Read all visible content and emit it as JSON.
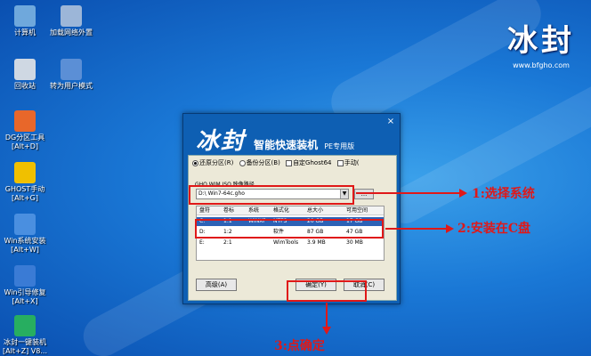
{
  "desktop": {
    "icons": [
      {
        "label": "计算机",
        "color": "#6fa8dc"
      },
      {
        "label": "加载网络外置",
        "color": "#9cb6d8"
      },
      {
        "label": "回收站",
        "color": "#cfd8e3"
      },
      {
        "label": "转为用户模式",
        "color": "#5b8fd6"
      },
      {
        "label": "DG分区工具",
        "label2": "[Alt+D]",
        "color": "#e8672a"
      },
      {
        "label": "GHOST手动",
        "label2": "[Alt+G]",
        "color": "#f0c000"
      },
      {
        "label": "Win系统安装",
        "label2": "[Alt+W]",
        "color": "#4a8fe0"
      },
      {
        "label": "Win引导修复",
        "label2": "[Alt+X]",
        "color": "#3a7bd5"
      },
      {
        "label": "冰封一键装机",
        "label2": "[Alt+Z] V8...",
        "color": "#27ae60"
      }
    ],
    "brand_title": "冰封",
    "brand_url": "www.bfgho.com"
  },
  "window": {
    "title_main": "冰封",
    "title_sub": "智能快速装机",
    "title_pe": "PE专用版",
    "close_label": "×",
    "options": [
      {
        "label": "还原分区(R)",
        "checked": true,
        "kind": "radio"
      },
      {
        "label": "备份分区(B)",
        "checked": false,
        "kind": "radio"
      },
      {
        "label": "自定Ghost64",
        "checked": false,
        "kind": "check"
      },
      {
        "label": "手动(",
        "checked": false,
        "kind": "check"
      }
    ],
    "path_label": "GHO WIM ISO 映像路径",
    "path_value": "D:\\ Win7-64c.gho",
    "browse_label": "...",
    "table": {
      "headers": [
        "盘符",
        "卷标",
        "系统",
        "格式化",
        "总大小",
        "可用空间"
      ],
      "rows": [
        [
          "C:",
          "1:1",
          "WINXP",
          "NTFS",
          "20 GB",
          "17 GB"
        ],
        [
          "D:",
          "1:2",
          "",
          "软件",
          "87 GB",
          "47 GB"
        ],
        [
          "E:",
          "2:1",
          "",
          "WimTools",
          "3.9 MB",
          "30 MB"
        ]
      ],
      "selected_row": 0
    },
    "buttons": {
      "advanced": "高级(A)",
      "ok": "确定(Y)",
      "cancel": "取消(C)"
    }
  },
  "annotations": {
    "step1": "1:选择系统",
    "step2": "2:安装在C盘",
    "step3": "3:点确定",
    "color": "#e01818"
  }
}
